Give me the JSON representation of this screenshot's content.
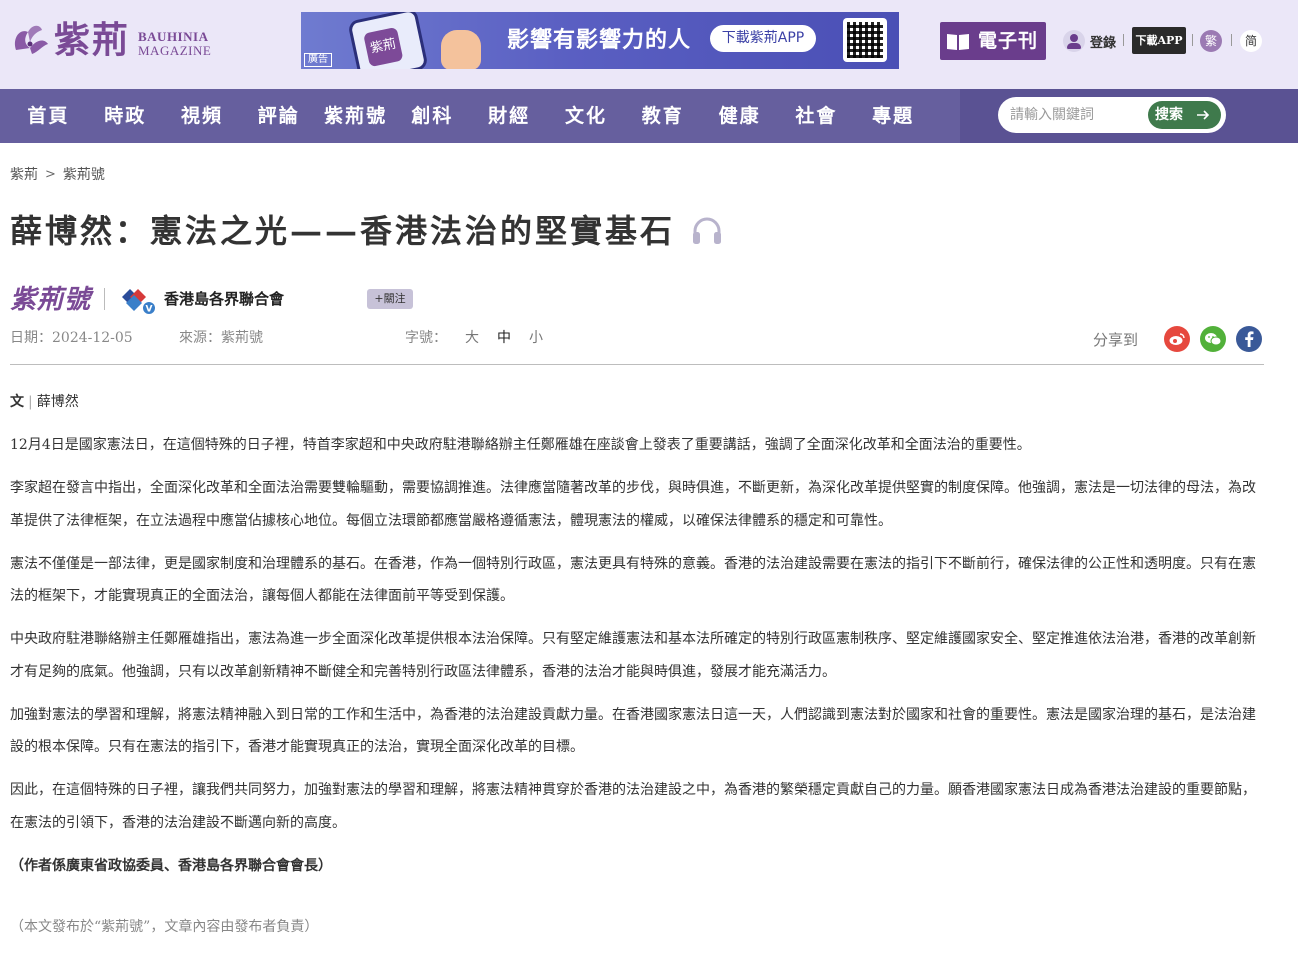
{
  "header": {
    "logo_cn": "紫荊",
    "logo_en_line1": "BAUHINIA",
    "logo_en_line2": "MAGAZINE",
    "ad": {
      "slogan": "影響有影響力的人",
      "cta": "下載紫荊APP",
      "tag": "廣告",
      "phone_text": "紫荊"
    },
    "ebook_label": "電子刊",
    "login_label": "登錄",
    "download_app": "下載APP",
    "lang_traditional": "繁",
    "lang_simplified": "简"
  },
  "nav": {
    "items": [
      "首頁",
      "時政",
      "視頻",
      "評論",
      "紫荊號",
      "創科",
      "財經",
      "文化",
      "教育",
      "健康",
      "社會",
      "專題"
    ],
    "search_placeholder": "請輸入關鍵詞",
    "search_button": "搜索"
  },
  "breadcrumb": [
    "紫荊",
    "紫荊號"
  ],
  "article": {
    "title": "薛博然：憲法之光——香港法治的堅實基石",
    "channel_logo": "紫荊號",
    "org_name": "香港島各界聯合會",
    "follow_label": "+關注",
    "date": "日期：2024-12-05",
    "source": "來源：紫荊號",
    "font_size_label": "字號：",
    "font_sizes": [
      "大",
      "中",
      "小"
    ],
    "active_font_size": "中",
    "share_label": "分享到",
    "byline_prefix": "文",
    "byline_author": "薛博然",
    "paragraphs": [
      "12月4日是國家憲法日，在這個特殊的日子裡，特首李家超和中央政府駐港聯絡辦主任鄭雁雄在座談會上發表了重要講話，強調了全面深化改革和全面法治的重要性。",
      "李家超在發言中指出，全面深化改革和全面法治需要雙輪驅動，需要協調推進。法律應當隨著改革的步伐，與時俱進，不斷更新，為深化改革提供堅實的制度保障。他強調，憲法是一切法律的母法，為改革提供了法律框架，在立法過程中應當佔據核心地位。每個立法環節都應當嚴格遵循憲法，體現憲法的權威，以確保法律體系的穩定和可靠性。",
      "憲法不僅僅是一部法律，更是國家制度和治理體系的基石。在香港，作為一個特別行政區，憲法更具有特殊的意義。香港的法治建設需要在憲法的指引下不斷前行，確保法律的公正性和透明度。只有在憲法的框架下，才能實現真正的全面法治，讓每個人都能在法律面前平等受到保護。",
      "中央政府駐港聯絡辦主任鄭雁雄指出，憲法為進一步全面深化改革提供根本法治保障。只有堅定維護憲法和基本法所確定的特別行政區憲制秩序、堅定維護國家安全、堅定推進依法治港，香港的改革創新才有足夠的底氣。他強調，只有以改革創新精神不斷健全和完善特別行政區法律體系，香港的法治才能與時俱進，發展才能充滿活力。",
      "加強對憲法的學習和理解，將憲法精神融入到日常的工作和生活中，為香港的法治建設貢獻力量。在香港國家憲法日這一天，人們認識到憲法對於國家和社會的重要性。憲法是國家治理的基石，是法治建設的根本保障。只有在憲法的指引下，香港才能實現真正的法治，實現全面深化改革的目標。",
      "因此，在這個特殊的日子裡，讓我們共同努力，加強對憲法的學習和理解，將憲法精神貫穿於香港的法治建設之中，為香港的繁榮穩定貢獻自己的力量。願香港國家憲法日成為香港法治建設的重要節點，在憲法的引領下，香港的法治建設不斷邁向新的高度。"
    ],
    "author_note": "（作者係廣東省政協委員、香港島各界聯合會會長）",
    "disclaimer": "（本文發布於“紫荊號”，文章內容由發布者負責）"
  },
  "colors": {
    "topbar_bg": "#ebe7f8",
    "nav_bg": "#665f9e",
    "brand_purple": "#7a4a96",
    "search_button_bg": "#3f7a4c"
  },
  "icons": {
    "headphone": "headphone-icon",
    "weibo": "weibo-icon",
    "wechat": "wechat-icon",
    "facebook": "facebook-icon",
    "user": "user-icon",
    "book": "book-icon",
    "arrow": "arrow-right-icon"
  }
}
